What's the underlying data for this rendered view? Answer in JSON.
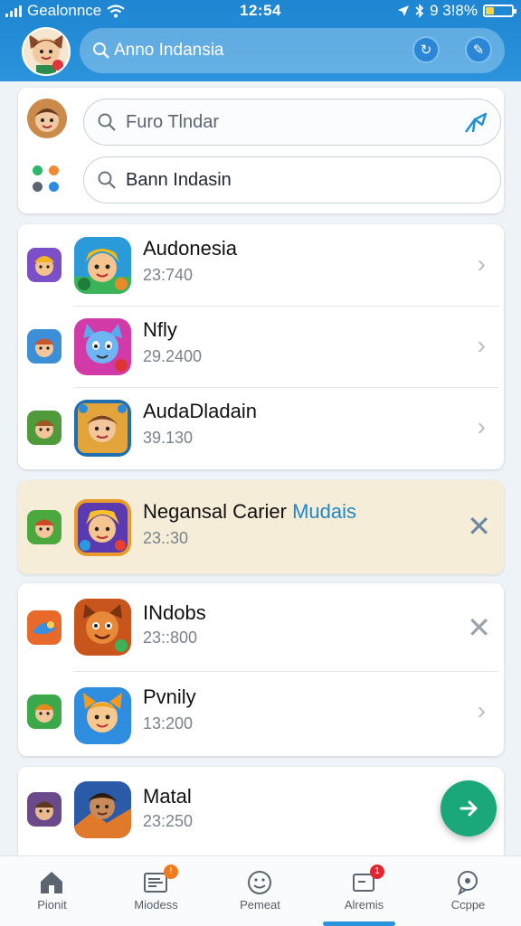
{
  "status_bar": {
    "carrier": "Gealonnce",
    "time": "12:54",
    "battery": "9 3!8%"
  },
  "header": {
    "search_text": "Anno Indansia"
  },
  "search_card": {
    "field_1": "Furo Tlndar",
    "field_2": "Bann Indasin"
  },
  "list_group_1": [
    {
      "title": "Audonesia",
      "subtitle": "23:740"
    },
    {
      "title": "Nfly",
      "subtitle": "29.2400"
    },
    {
      "title": "AudaDladain",
      "subtitle": "39.130"
    }
  ],
  "highlighted": {
    "title": "Negansal Carier",
    "title_accent": "Mudais",
    "subtitle": "23.:30"
  },
  "list_group_2": [
    {
      "title": "INdobs",
      "subtitle": "23::800"
    },
    {
      "title": "Pvnily",
      "subtitle": "13:200"
    }
  ],
  "list_group_3": [
    {
      "title": "Matal",
      "subtitle": "23:250"
    }
  ],
  "bottom_nav": [
    {
      "label": "Pionit",
      "icon": "home-icon"
    },
    {
      "label": "Miodess",
      "icon": "messages-icon",
      "badge": "!"
    },
    {
      "label": "Pemeat",
      "icon": "smile-icon"
    },
    {
      "label": "Alremis",
      "icon": "alerts-icon",
      "badge": "1"
    },
    {
      "label": "Ccppe",
      "icon": "chat-icon"
    }
  ],
  "colors": {
    "header": "#2b93db",
    "highlight": "#f5edd7",
    "fab": "#1aa87a",
    "accent_text": "#1e88c8"
  }
}
